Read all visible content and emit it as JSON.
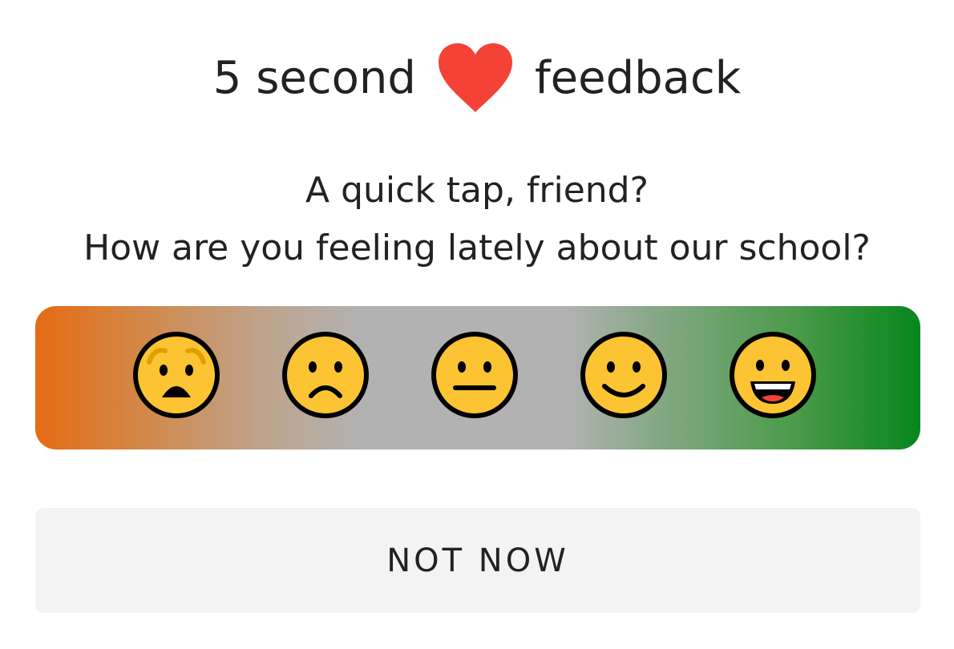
{
  "header": {
    "title_before": "5 second",
    "title_after": "feedback",
    "heart_icon": "heart-icon",
    "heart_color": "#f44336"
  },
  "prompt": {
    "line1": "A quick tap, friend?",
    "line2": "How are you feeling lately about our school?"
  },
  "rating": {
    "gradient_start": "#e56b14",
    "gradient_mid": "#b2b2b2",
    "gradient_end": "#07861c",
    "options": [
      {
        "icon": "anguished-face-icon"
      },
      {
        "icon": "frowning-face-icon"
      },
      {
        "icon": "neutral-face-icon"
      },
      {
        "icon": "slightly-smiling-face-icon"
      },
      {
        "icon": "grinning-face-icon"
      }
    ]
  },
  "actions": {
    "dismiss_label": "NOT NOW"
  }
}
